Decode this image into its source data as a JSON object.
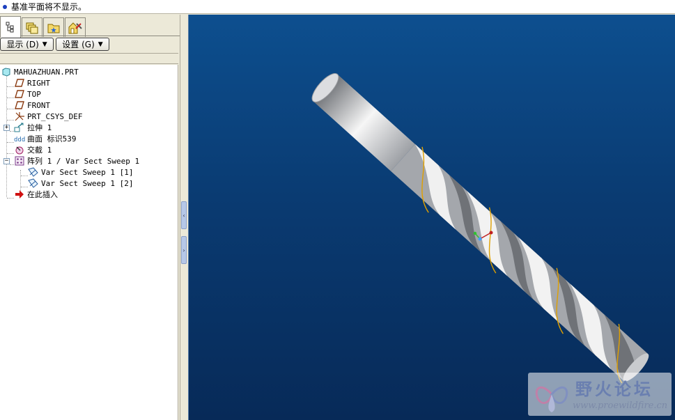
{
  "message_bar": {
    "text": "基准平面将不显示。"
  },
  "tabs": [
    {
      "icon": "model-tree-icon",
      "active": true
    },
    {
      "icon": "layers-icon",
      "active": false
    },
    {
      "icon": "favorites-folder-icon",
      "active": false
    },
    {
      "icon": "connection-tools-icon",
      "active": false
    }
  ],
  "toolbar": {
    "show_label": "显示 (D)",
    "settings_label": "设置 (G)"
  },
  "tree": {
    "root": "MAHUAZHUAN.PRT",
    "items": [
      {
        "label": "RIGHT",
        "icon": "datum-plane-icon"
      },
      {
        "label": "TOP",
        "icon": "datum-plane-icon"
      },
      {
        "label": "FRONT",
        "icon": "datum-plane-icon"
      },
      {
        "label": "PRT_CSYS_DEF",
        "icon": "coordinate-system-icon"
      },
      {
        "label": "拉伸 1",
        "icon": "extrude-icon"
      },
      {
        "label": "曲面 标识539",
        "icon": "surface-icon"
      },
      {
        "label": "交截 1",
        "icon": "intersect-icon"
      },
      {
        "label": "阵列 1 / Var Sect Sweep 1",
        "icon": "pattern-icon"
      },
      {
        "label": "Var Sect Sweep 1 [1]",
        "icon": "sweep-icon"
      },
      {
        "label": "Var Sect Sweep 1 [2]",
        "icon": "sweep-icon"
      },
      {
        "label": "在此插入",
        "icon": "insert-here-arrow-icon"
      }
    ]
  },
  "watermark": {
    "title": "野火论坛",
    "url": "www.proewildfire.cn"
  },
  "colors": {
    "viewport_top": "#0d4f8f",
    "viewport_bottom": "#072a58",
    "curve": "#e0a000"
  }
}
